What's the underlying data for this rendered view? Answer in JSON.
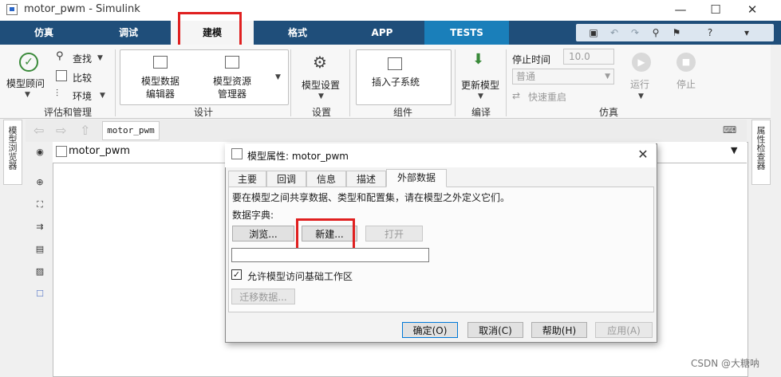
{
  "window": {
    "title": "motor_pwm - Simulink",
    "minimize": "—",
    "maximize": "☐",
    "close": "✕"
  },
  "tabs": [
    {
      "label": "仿真"
    },
    {
      "label": "调试"
    },
    {
      "label": "建模"
    },
    {
      "label": "格式"
    },
    {
      "label": "APP"
    },
    {
      "label": "TESTS"
    }
  ],
  "ribbon": {
    "model_advisor": "模型顾问",
    "find": "查找",
    "compare": "比较",
    "environment": "环境",
    "group_evaluate": "评估和管理",
    "model_data_editor_1": "模型数据",
    "model_data_editor_2": "编辑器",
    "model_explorer_1": "模型资源",
    "model_explorer_2": "管理器",
    "group_design": "设计",
    "model_settings": "模型设置",
    "group_setup": "设置",
    "insert_subsystem": "插入子系统",
    "group_component": "组件",
    "update_model": "更新模型",
    "group_compile": "编译",
    "stop_time_label": "停止时间",
    "stop_time_value": "10.0",
    "mode_value": "普通",
    "fast_restart": "快速重启",
    "run": "运行",
    "stop": "停止",
    "group_simulation": "仿真"
  },
  "side": {
    "left_label": "模型浏览器",
    "right_label": "属性检查器"
  },
  "nav": {
    "breadcrumb": "motor_pwm"
  },
  "canvas": {
    "title": "motor_pwm"
  },
  "dialog": {
    "title": "模型属性: motor_pwm",
    "tabs": [
      {
        "label": "主要"
      },
      {
        "label": "回调"
      },
      {
        "label": "信息"
      },
      {
        "label": "描述"
      },
      {
        "label": "外部数据"
      }
    ],
    "description": "要在模型之间共享数据、类型和配置集，请在模型之外定义它们。",
    "dict_label": "数据字典:",
    "browse": "浏览...",
    "new": "新建...",
    "open": "打开",
    "dict_input_value": "",
    "checkbox_label": "允许模型访问基础工作区",
    "checkbox_checked": "✓",
    "migrate": "迁移数据...",
    "ok": "确定(O)",
    "cancel": "取消(C)",
    "help": "帮助(H)",
    "apply": "应用(A)"
  },
  "watermark": "CSDN @大糖呐",
  "colors": {
    "tabbar": "#1f4e7a",
    "tests_tab": "#1a7fba",
    "highlight": "#e02020"
  }
}
